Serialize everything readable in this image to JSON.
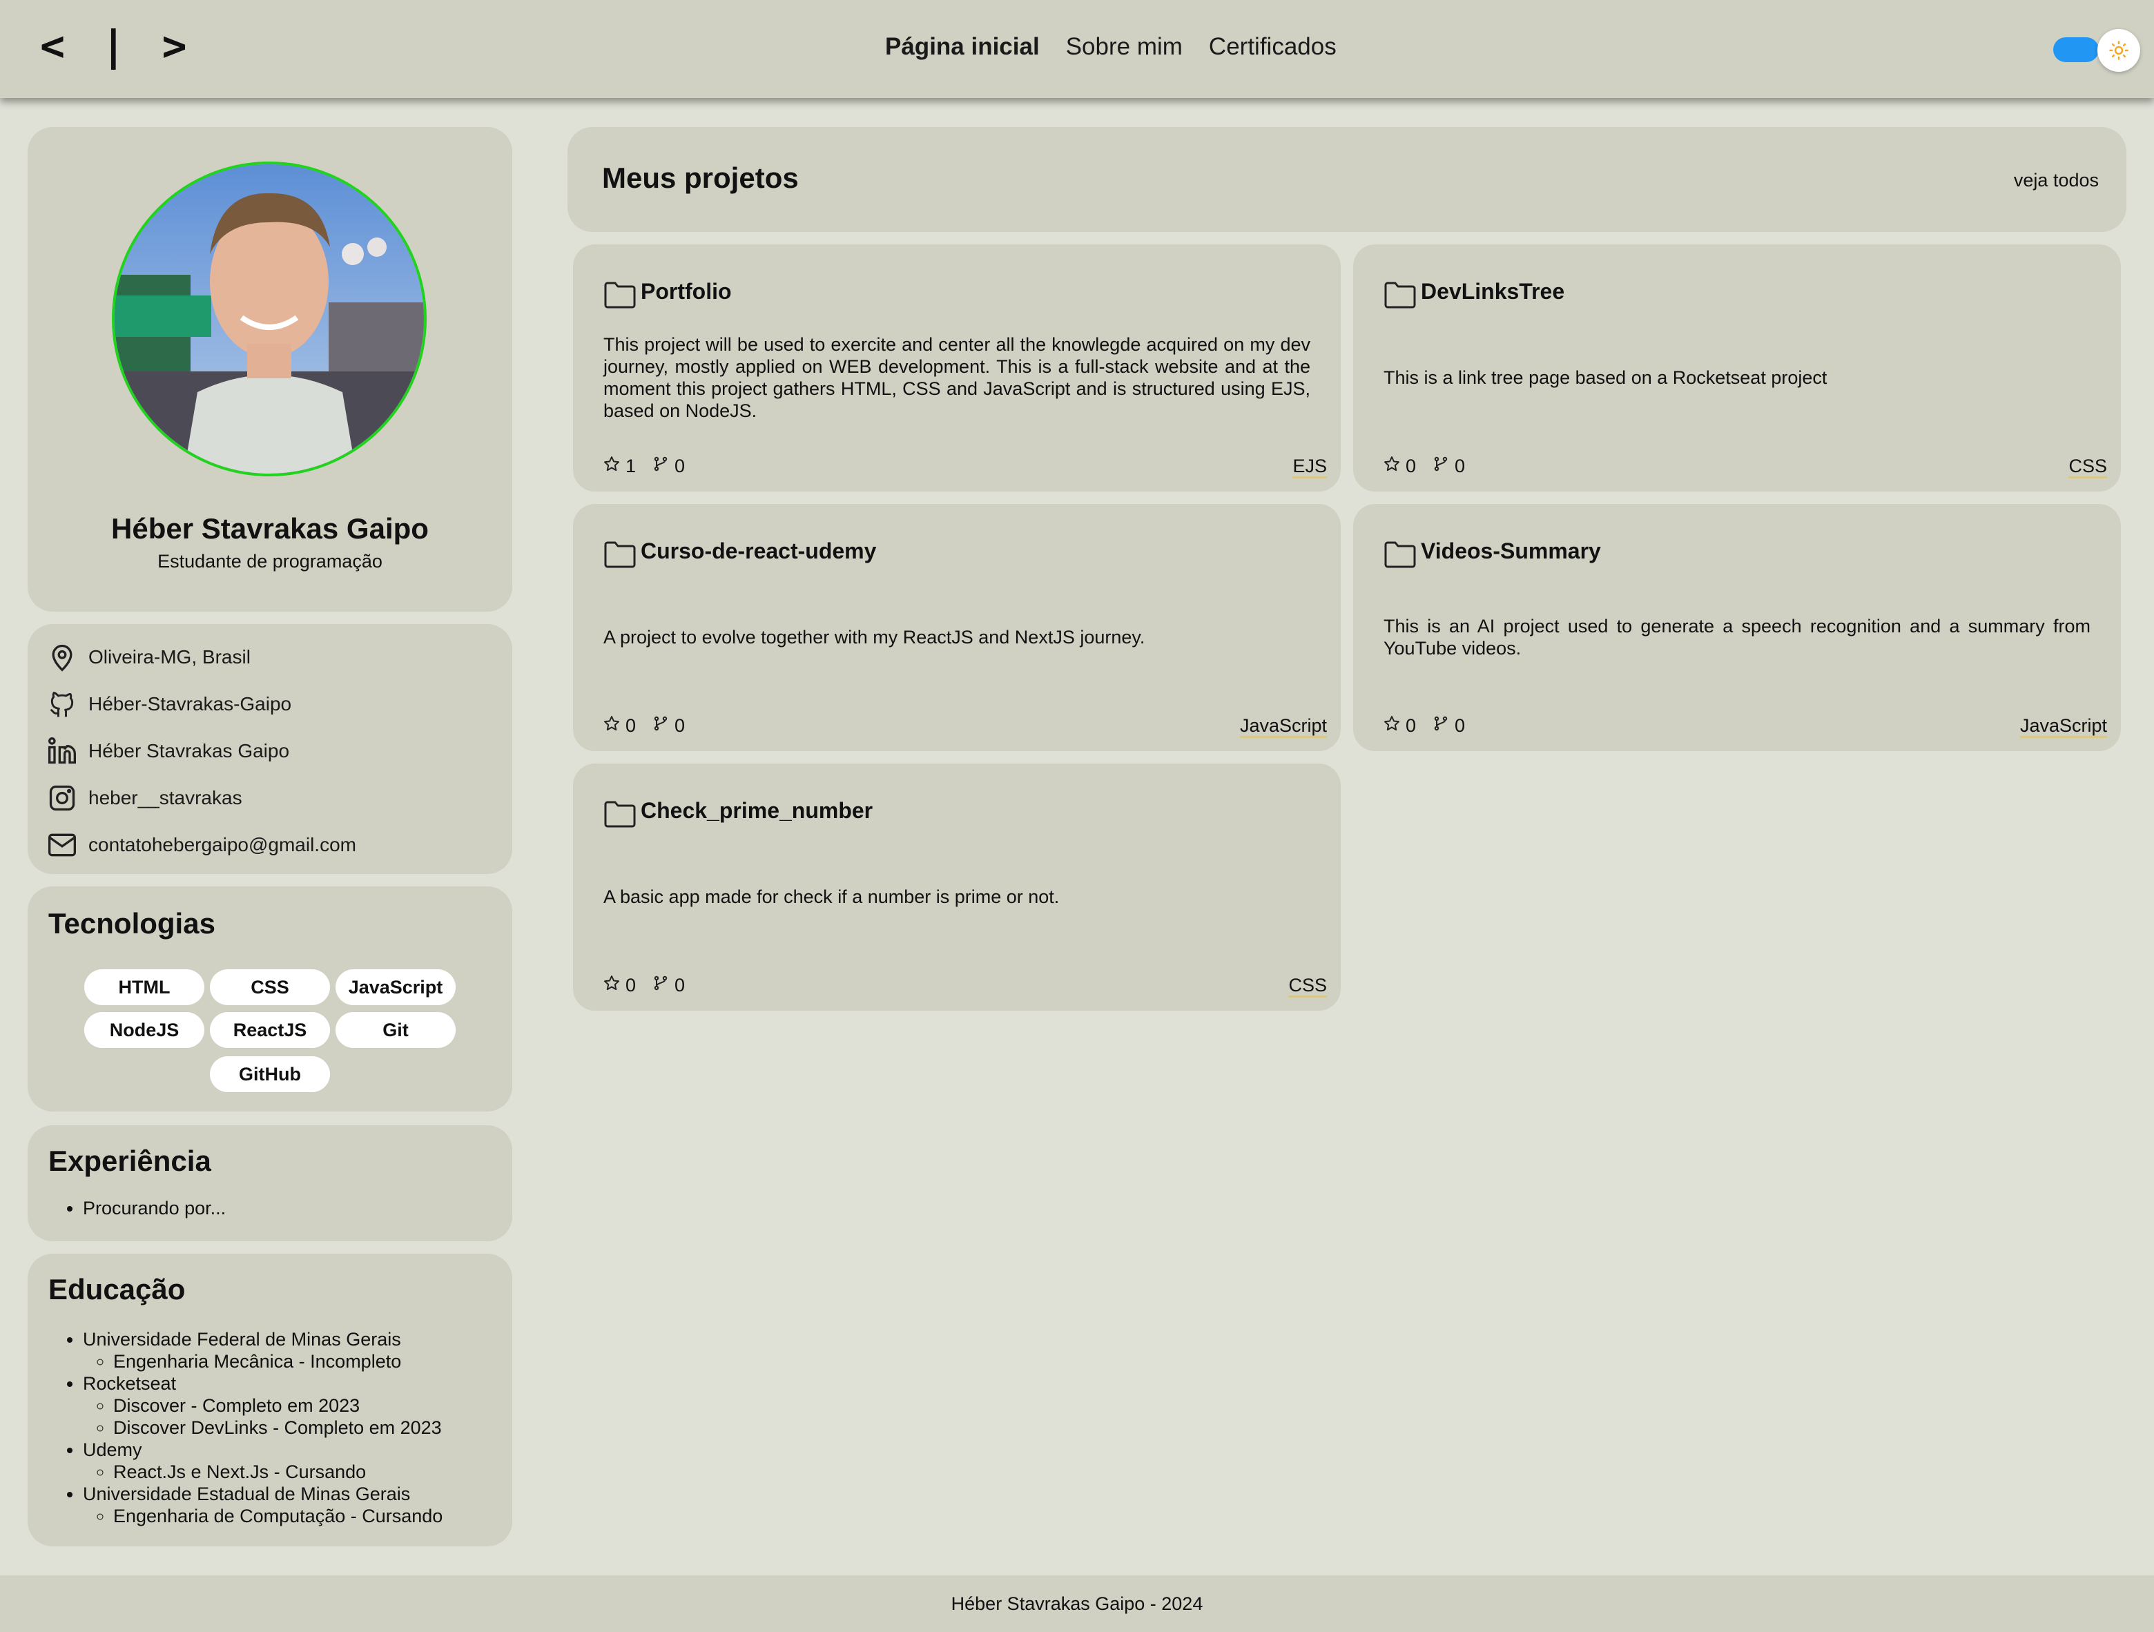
{
  "header": {
    "logo": "< | >",
    "nav": [
      "Página inicial",
      "Sobre mim",
      "Certificados"
    ],
    "theme_toggle": "on"
  },
  "profile": {
    "name": "Héber Stavrakas Gaipo",
    "role": "Estudante de programação"
  },
  "contacts": [
    {
      "icon": "map-pin-icon",
      "label": "Oliveira-MG, Brasil"
    },
    {
      "icon": "github-icon",
      "label": "Héber-Stavrakas-Gaipo"
    },
    {
      "icon": "linkedin-icon",
      "label": "Héber Stavrakas Gaipo"
    },
    {
      "icon": "instagram-icon",
      "label": "heber__stavrakas"
    },
    {
      "icon": "mail-icon",
      "label": "contatohebergaipo@gmail.com"
    }
  ],
  "technologies": {
    "title": "Tecnologias",
    "items": [
      "HTML",
      "CSS",
      "JavaScript",
      "NodeJS",
      "ReactJS",
      "Git",
      "GitHub"
    ]
  },
  "experience": {
    "title": "Experiência",
    "items": [
      "Procurando por..."
    ]
  },
  "education": {
    "title": "Educação",
    "items": [
      {
        "school": "Universidade Federal de Minas Gerais",
        "courses": [
          "Engenharia Mecânica - Incompleto"
        ]
      },
      {
        "school": "Rocketseat",
        "courses": [
          "Discover - Completo em 2023",
          "Discover DevLinks - Completo em 2023"
        ]
      },
      {
        "school": "Udemy",
        "courses": [
          "React.Js e Next.Js - Cursando"
        ]
      },
      {
        "school": "Universidade Estadual de Minas Gerais",
        "courses": [
          "Engenharia de Computação - Cursando"
        ]
      }
    ]
  },
  "projects": {
    "title": "Meus projetos",
    "see_all": "veja todos",
    "items": [
      {
        "name": "Portfolio",
        "description": "This project will be used to exercite and center all the knowlegde acquired on my dev journey, mostly applied on WEB development. This is a full-stack website and at the moment this project gathers HTML, CSS and JavaScript and is structured using EJS, based on NodeJS.",
        "stars": "1",
        "forks": "0",
        "language": "EJS"
      },
      {
        "name": "DevLinksTree",
        "description": "This is a link tree page based on a Rocketseat project",
        "stars": "0",
        "forks": "0",
        "language": "CSS"
      },
      {
        "name": "Curso-de-react-udemy",
        "description": "A project to evolve together with my ReactJS and NextJS journey.",
        "stars": "0",
        "forks": "0",
        "language": "JavaScript"
      },
      {
        "name": "Videos-Summary",
        "description": "This is an AI project used to generate a speech recognition and a summary from YouTube videos.",
        "stars": "0",
        "forks": "0",
        "language": "JavaScript"
      },
      {
        "name": "Check_prime_number",
        "description": "A basic app made for check if a number is prime or not.",
        "stars": "0",
        "forks": "0",
        "language": "CSS"
      }
    ]
  },
  "footer": {
    "text": "Héber Stavrakas Gaipo - 2024"
  },
  "colors": {
    "background": "#dfe0d6",
    "card": "#d0d1c3",
    "toggle_track": "#2196f3",
    "avatar_border": "#22d31e",
    "sun_icon": "#f5a623"
  }
}
